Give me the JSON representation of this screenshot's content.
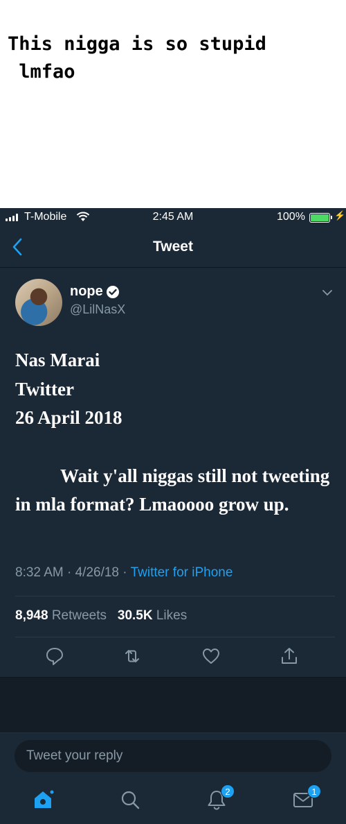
{
  "caption": {
    "text": "This nigga is so stupid\n lmfao"
  },
  "status_bar": {
    "carrier": "T-Mobile",
    "time": "2:45 AM",
    "battery_percent": "100%",
    "battery_level": 1.0
  },
  "header": {
    "title": "Tweet"
  },
  "tweet": {
    "display_name": "nope",
    "verified": true,
    "handle": "@LilNasX",
    "body": {
      "line1": "Nas Marai",
      "line2": "Twitter",
      "line3": "26 April 2018",
      "paragraph": "Wait y'all niggas still not tweeting in mla format? Lmaoooo grow up."
    },
    "time": "8:32 AM",
    "date": "4/26/18",
    "separator": "·",
    "source": "Twitter for iPhone",
    "retweets_count": "8,948",
    "retweets_label": "Retweets",
    "likes_count": "30.5K",
    "likes_label": "Likes"
  },
  "reply": {
    "placeholder": "Tweet your reply"
  },
  "tab_bar": {
    "notifications_badge": "2",
    "messages_badge": "1"
  },
  "colors": {
    "accent": "#1da1f2",
    "background": "#141d26",
    "card": "#1b2836",
    "muted": "#8899a6",
    "battery": "#4cd964"
  },
  "icons": [
    "signal-icon",
    "wifi-icon",
    "battery-icon",
    "charging-icon",
    "back-chevron-icon",
    "verified-icon",
    "caret-down-icon",
    "reply-icon",
    "retweet-icon",
    "like-icon",
    "share-icon",
    "home-icon",
    "search-icon",
    "notifications-icon",
    "messages-icon"
  ]
}
